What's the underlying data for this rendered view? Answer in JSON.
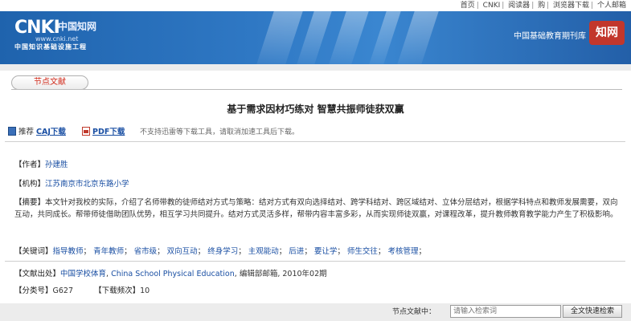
{
  "top_links": {
    "home": "首页",
    "cnki": "CNKI",
    "card": "阅读器",
    "buy": "购",
    "download": "浏览器下载",
    "mail": "个人邮箱"
  },
  "banner": {
    "logo_main": "CNKI",
    "logo_cn": "中国知网",
    "logo_url": "www.cnki.net",
    "logo_sub": "中国知识基础设施工程",
    "site_title": "中国基础教育期刊库",
    "badge": "知网"
  },
  "node_button": "节点文献",
  "article": {
    "title": "基于需求因材巧练对 智慧共振师徒获双赢"
  },
  "downloads": {
    "caj_prefix": "推荐",
    "caj_link": "CAJ下载",
    "pdf_link": "PDF下载",
    "note": "不支持迅雷等下载工具，请取消加速工具后下载。"
  },
  "meta": {
    "author_label": "【作者】",
    "author": "孙建胜",
    "org_label": "【机构】",
    "org": "江苏南京市北京东路小学",
    "abstract_label": "【摘要】",
    "abstract": "本文针对我校的实际，介绍了名师带教的徒师结对方式与策略：结对方式有双向选择结对、跨学科结对、跨区域结对、立体分层结对，根据学科特点和教师发展需要，双向互动，共同成长。帮带师徒借助团队优势，相互学习共同提升。结对方式灵活多样，帮带内容丰富多彩，从而实现师徒双赢，对课程改革，提升教师教育教学能力产生了积极影响。",
    "keywords_label": "【关键词】",
    "keywords": [
      "指导教师",
      "青年教师",
      "省市级",
      "双向互动",
      "终身学习",
      "主观能动",
      "后进",
      "要让学",
      "师生交往",
      "考核管理"
    ],
    "source_label": "【文献出处】",
    "source_journal": "中国学校体育",
    "source_en": "China School Physical Education",
    "source_editorial": "编辑部邮箱",
    "source_issue": "2010年02期",
    "class_label": "【分类号】",
    "class_value": "G627",
    "downloads_label": "【下载频次】",
    "downloads_value": "10"
  },
  "search": {
    "label": "节点文献中：",
    "placeholder": "请输入检索词",
    "button": "全文快速检索"
  }
}
